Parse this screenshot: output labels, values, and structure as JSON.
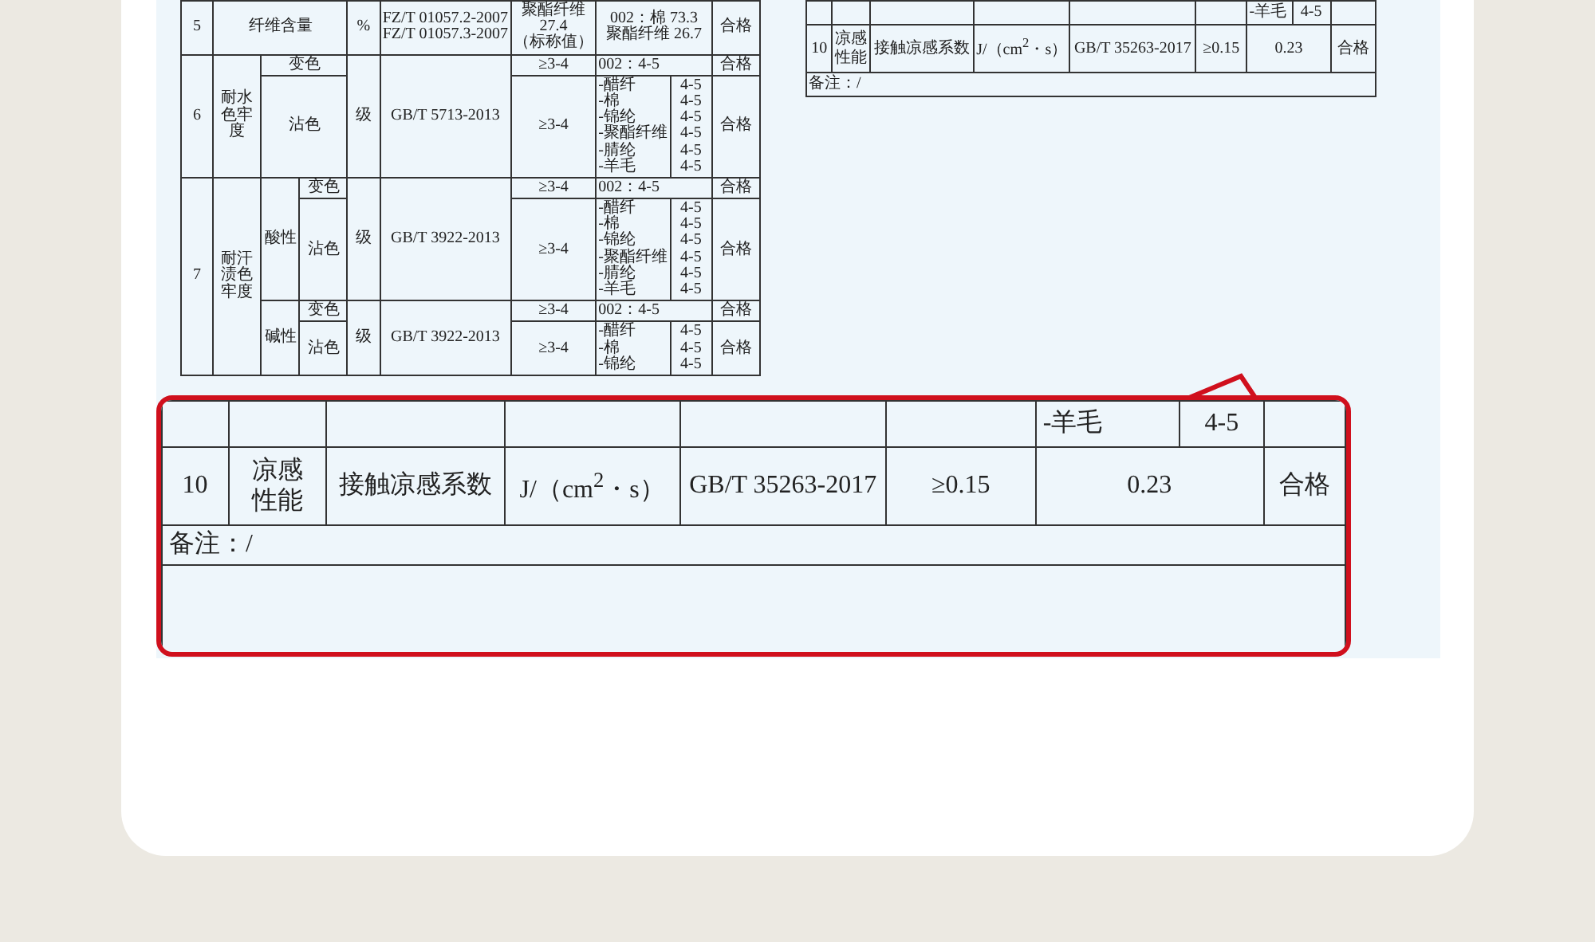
{
  "left_table": {
    "fiber_row": {
      "no": "5",
      "item": "纤维含量",
      "unit": "%",
      "standards": [
        "FZ/T 01057.2-2007",
        "FZ/T 01057.3-2007"
      ],
      "requirement": [
        "聚酯纤维",
        "27.4",
        "（标称值）"
      ],
      "result": [
        "002：棉 73.3",
        "聚酯纤维 26.7"
      ],
      "verdict": "合格"
    },
    "colorfastness": [
      {
        "no": "6",
        "name": "耐水色牢度",
        "groups": [
          {
            "unit": "级",
            "standard": "GB/T 5713-2013",
            "change": {
              "label": "变色",
              "requirement": "≥3-4",
              "result": "002：4-5",
              "verdict": "合格"
            },
            "stain": {
              "label": "沾色",
              "requirement": "≥3-4",
              "items": [
                {
                  "name": "-醋纤",
                  "grade": "4-5"
                },
                {
                  "name": "-棉",
                  "grade": "4-5"
                },
                {
                  "name": "-锦纶",
                  "grade": "4-5"
                },
                {
                  "name": "-聚酯纤维",
                  "grade": "4-5"
                },
                {
                  "name": "-腈纶",
                  "grade": "4-5"
                },
                {
                  "name": "-羊毛",
                  "grade": "4-5"
                }
              ],
              "verdict": "合格"
            }
          }
        ]
      },
      {
        "no": "7",
        "name": "耐汗渍色牢度",
        "groups": [
          {
            "sub": "酸性",
            "unit": "级",
            "standard": "GB/T 3922-2013",
            "change": {
              "label": "变色",
              "requirement": "≥3-4",
              "result": "002：4-5",
              "verdict": "合格"
            },
            "stain": {
              "label": "沾色",
              "requirement": "≥3-4",
              "items": [
                {
                  "name": "-醋纤",
                  "grade": "4-5"
                },
                {
                  "name": "-棉",
                  "grade": "4-5"
                },
                {
                  "name": "-锦纶",
                  "grade": "4-5"
                },
                {
                  "name": "-聚酯纤维",
                  "grade": "4-5"
                },
                {
                  "name": "-腈纶",
                  "grade": "4-5"
                },
                {
                  "name": "-羊毛",
                  "grade": "4-5"
                }
              ],
              "verdict": "合格"
            }
          },
          {
            "sub": "碱性",
            "unit": "级",
            "standard": "GB/T 3922-2013",
            "change": {
              "label": "变色",
              "requirement": "≥3-4",
              "result": "002：4-5",
              "verdict": "合格"
            },
            "stain": {
              "label": "沾色",
              "requirement": "≥3-4",
              "items": [
                {
                  "name": "-醋纤",
                  "grade": "4-5"
                },
                {
                  "name": "-棉",
                  "grade": "4-5"
                },
                {
                  "name": "-锦纶",
                  "grade": "4-5"
                }
              ],
              "verdict": "合格"
            }
          }
        ]
      }
    ]
  },
  "right_table": {
    "partial_row": {
      "item": "-羊毛",
      "grade": "4-5"
    },
    "row": {
      "no": "10",
      "name": "凉感性能",
      "method": "接触凉感系数",
      "unit": "J/（cm$^{2}$・s）",
      "standard": "GB/T 35263-2017",
      "requirement": "≥0.15",
      "result": "0.23",
      "verdict": "合格"
    },
    "note": "备注：/"
  },
  "callout": {
    "partial_row": {
      "item": "-羊毛",
      "grade": "4-5"
    },
    "row": {
      "no": "10",
      "name": "凉感性能",
      "method": "接触凉感系数",
      "unit": "J/（cm$^{2}$・s）",
      "standard": "GB/T 35263-2017",
      "requirement": "≥0.15",
      "result": "0.23",
      "verdict": "合格"
    },
    "note": "备注：/"
  }
}
